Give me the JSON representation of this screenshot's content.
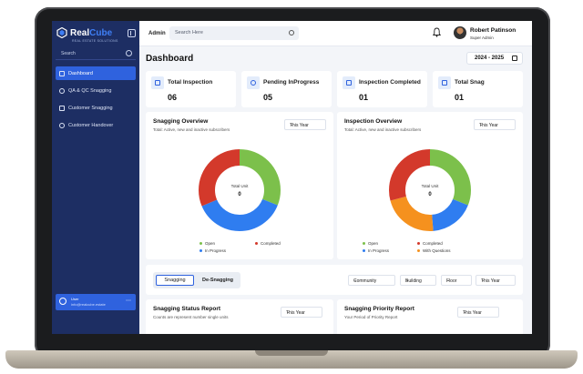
{
  "brand": {
    "name_part1": "Real",
    "name_part2": "Cube",
    "tagline": "REAL ESTATE SOLUTIONS"
  },
  "sidebar": {
    "search_placeholder": "Search",
    "items": [
      {
        "label": "Dashboard",
        "active": true
      },
      {
        "label": "QA & QC Snagging"
      },
      {
        "label": "Customer Snagging"
      },
      {
        "label": "Customer Handover"
      }
    ],
    "user": {
      "name": "User",
      "email": "info@realcube.estate"
    }
  },
  "topbar": {
    "admin_label": "Admin",
    "search_placeholder": "Search Here",
    "profile": {
      "name": "Robert Patinson",
      "role": "Super Admin"
    }
  },
  "page": {
    "title": "Dashboard",
    "year_range": "2024 - 2025"
  },
  "stats": [
    {
      "label": "Total Inspection",
      "value": "06"
    },
    {
      "label": "Pending InProgress",
      "value": "05"
    },
    {
      "label": "Inspection Completed",
      "value": "01"
    },
    {
      "label": "Total Snag",
      "value": "01"
    }
  ],
  "snagging_overview": {
    "title": "Snagging Overview",
    "subtitle": "Total: Active, new and inactive subscribers",
    "filter": "This Year",
    "center_label": "Total Unit",
    "center_value": "0",
    "legend": [
      "Open",
      "Completed",
      "In Progress"
    ],
    "colors": {
      "green": "#7cc04b",
      "red": "#d3392b",
      "blue": "#2f7df0",
      "orange": "#f5911e"
    }
  },
  "inspection_overview": {
    "title": "Inspection Overview",
    "subtitle": "Total: Active, new and inactive subscribers",
    "filter": "This Year",
    "center_label": "Total Unit",
    "center_value": "0",
    "legend": [
      "Open",
      "Completed",
      "In Progress",
      "With Questions"
    ]
  },
  "tabs": {
    "snagging": "Snagging",
    "de_snagging": "De-Snagging",
    "filters": [
      "Community",
      "Building",
      "Floor",
      "This Year"
    ]
  },
  "status_report": {
    "title": "Snagging Status Report",
    "subtitle": "Counts are represent number single units",
    "filter": "This Year"
  },
  "priority_report": {
    "title": "Snagging Priority Report",
    "subtitle": "Your Period of Priority Report",
    "filter": "This Year"
  }
}
